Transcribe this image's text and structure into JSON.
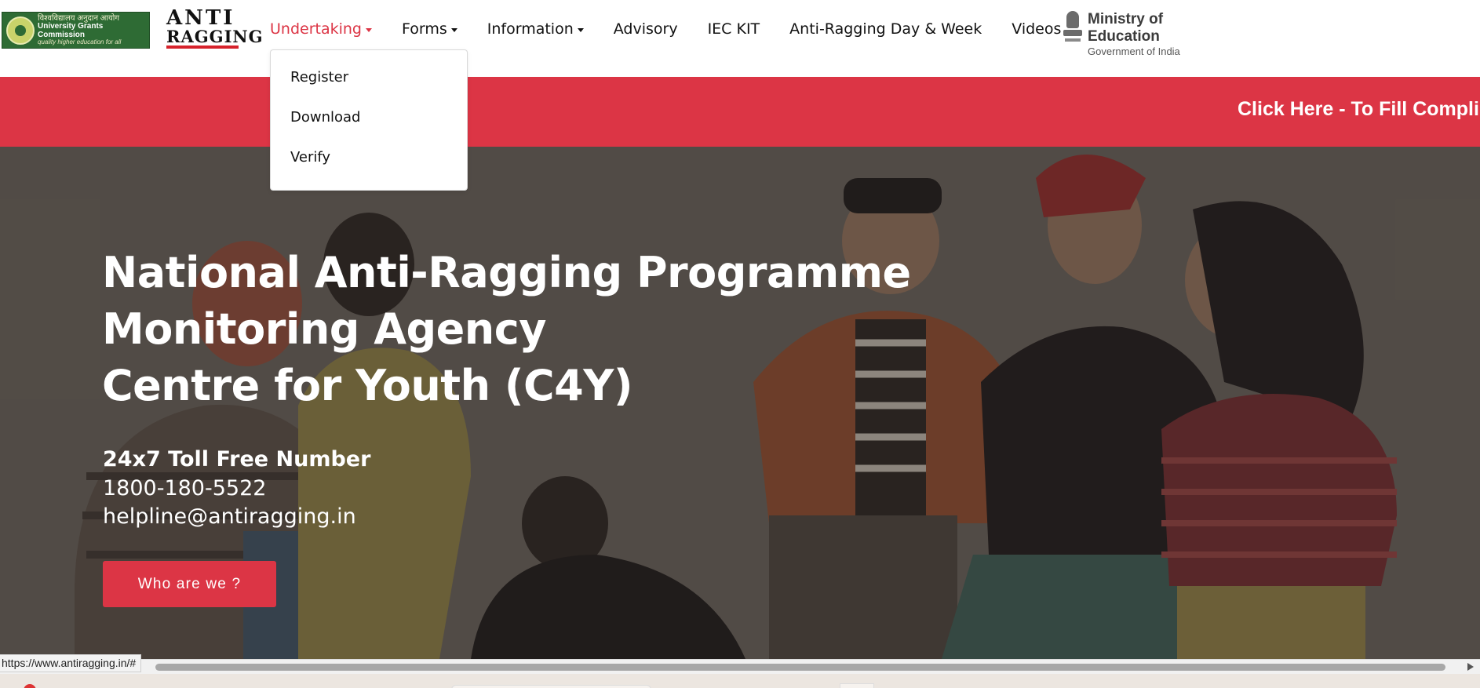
{
  "logos": {
    "ugc": {
      "hindi": "विश्वविद्यालय अनुदान आयोग",
      "name": "University Grants Commission",
      "tagline": "quality higher education for all"
    },
    "anti_ragging": {
      "line1": "ANTI",
      "line2": "RAGGING"
    },
    "ministry": {
      "title": "Ministry of Education",
      "subtitle": "Government of India"
    }
  },
  "nav": {
    "items": [
      {
        "label": "Undertaking",
        "dropdown": true,
        "active": true
      },
      {
        "label": "Forms",
        "dropdown": true
      },
      {
        "label": "Information",
        "dropdown": true
      },
      {
        "label": "Advisory"
      },
      {
        "label": "IEC KIT"
      },
      {
        "label": "Anti-Ragging Day & Week"
      },
      {
        "label": "Videos"
      }
    ]
  },
  "dropdown": {
    "items": [
      "Register",
      "Download",
      "Verify"
    ]
  },
  "banner": {
    "text": "Click Here - To Fill Compli"
  },
  "hero": {
    "title_lines": [
      "National Anti-Ragging Programme",
      "Monitoring Agency",
      "Centre for Youth (C4Y)"
    ],
    "toll_label": "24x7 Toll Free Number",
    "toll_number": "1800-180-5522",
    "email": "helpline@antiragging.in",
    "button_label": "Who are we ?"
  },
  "status_bar": {
    "url": "https://www.antiragging.in/#"
  },
  "colors": {
    "accent": "#dc3545",
    "ugc_green": "#2e6b34",
    "hero_bg": "#645e58"
  }
}
